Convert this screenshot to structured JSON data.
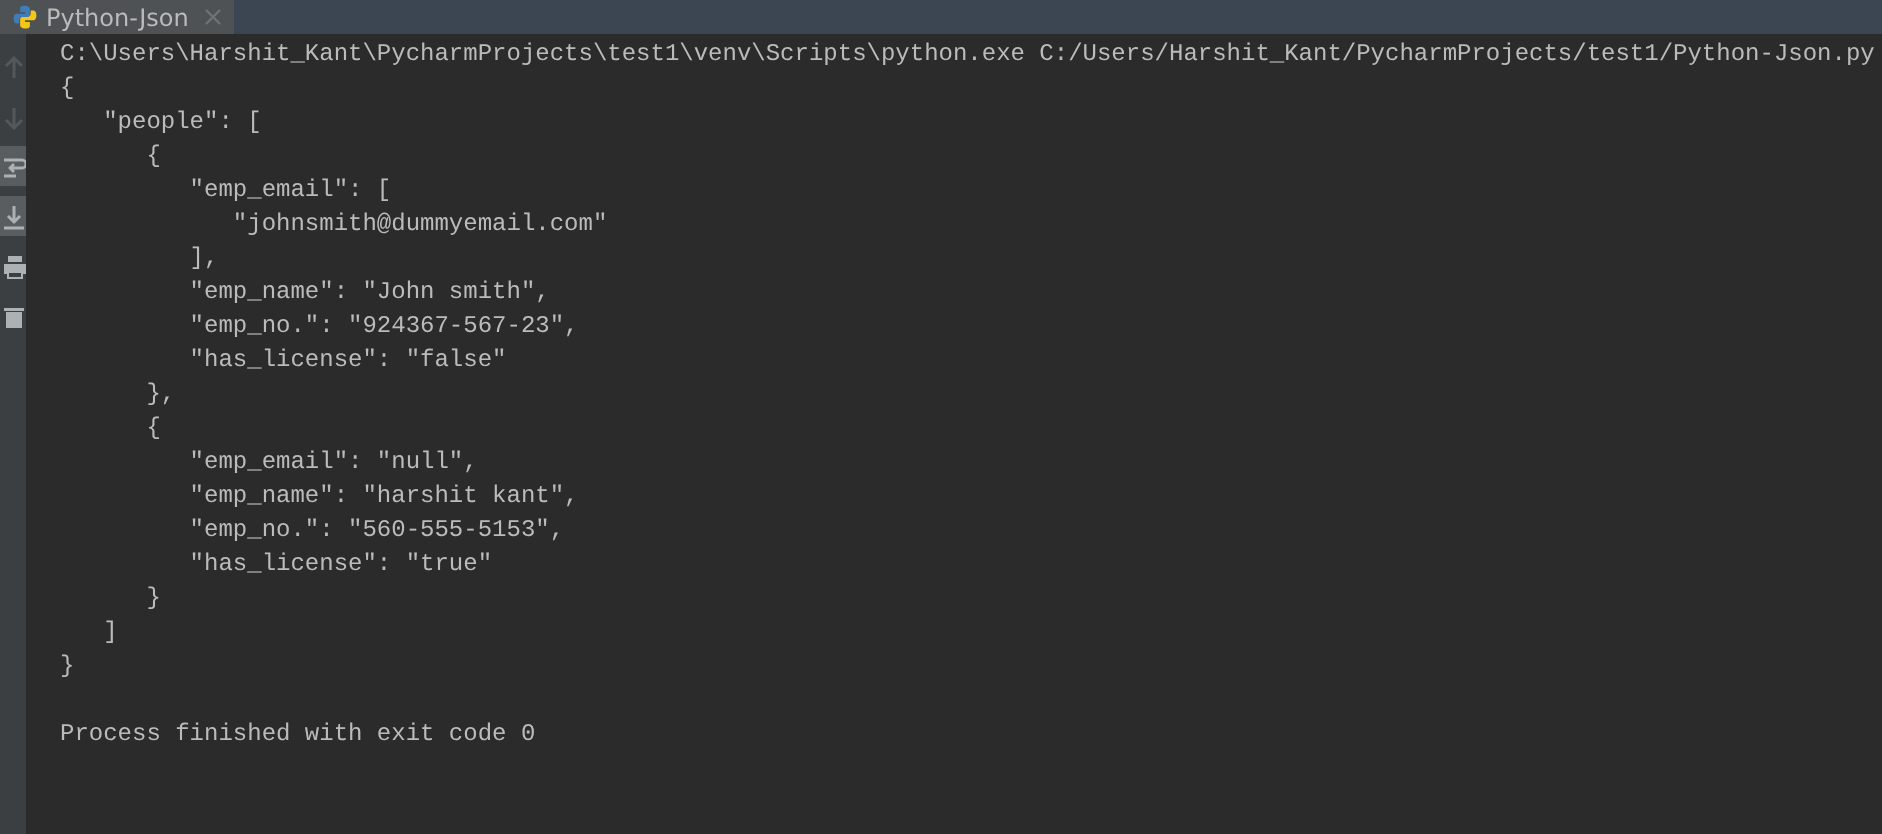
{
  "tabs": [
    {
      "label": "Python-Json",
      "selected": true
    }
  ],
  "toolbar": [
    {
      "kind": "up",
      "disabled": true,
      "selected": false
    },
    {
      "kind": "down",
      "disabled": true,
      "selected": false
    },
    {
      "kind": "wrap",
      "disabled": false,
      "selected": true
    },
    {
      "kind": "scroll-end",
      "disabled": false,
      "selected": true
    },
    {
      "kind": "print",
      "disabled": false,
      "selected": false
    },
    {
      "kind": "trash",
      "disabled": false,
      "selected": false
    }
  ],
  "console": {
    "lines": [
      "C:\\Users\\Harshit_Kant\\PycharmProjects\\test1\\venv\\Scripts\\python.exe C:/Users/Harshit_Kant/PycharmProjects/test1/Python-Json.py",
      "{",
      "   \"people\": [",
      "      {",
      "         \"emp_email\": [",
      "            \"johnsmith@dummyemail.com\"",
      "         ],",
      "         \"emp_name\": \"John smith\",",
      "         \"emp_no.\": \"924367-567-23\",",
      "         \"has_license\": \"false\"",
      "      },",
      "      {",
      "         \"emp_email\": \"null\",",
      "         \"emp_name\": \"harshit kant\",",
      "         \"emp_no.\": \"560-555-5153\",",
      "         \"has_license\": \"true\"",
      "      }",
      "   ]",
      "}"
    ],
    "exit_message": "Process finished with exit code 0"
  }
}
